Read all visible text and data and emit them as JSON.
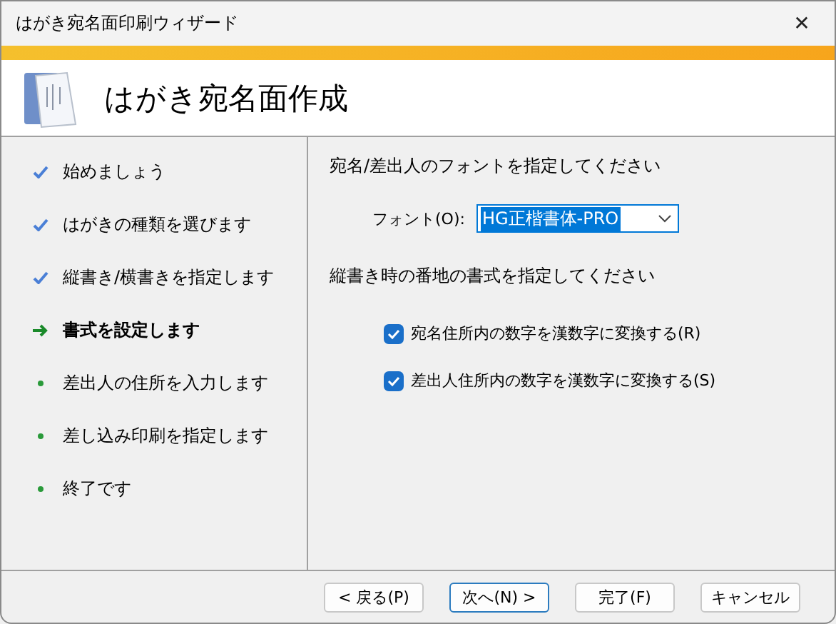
{
  "window": {
    "title": "はがき宛名面印刷ウィザード",
    "close": "✕"
  },
  "header": {
    "title": "はがき宛名面作成"
  },
  "steps": [
    {
      "label": "始めましょう",
      "kind": "done"
    },
    {
      "label": "はがきの種類を選びます",
      "kind": "done"
    },
    {
      "label": "縦書き/横書きを指定します",
      "kind": "done"
    },
    {
      "label": "書式を設定します",
      "kind": "current"
    },
    {
      "label": "差出人の住所を入力します",
      "kind": "pending"
    },
    {
      "label": "差し込み印刷を指定します",
      "kind": "pending"
    },
    {
      "label": "終了です",
      "kind": "pending"
    }
  ],
  "font_section": {
    "heading": "宛名/差出人のフォントを指定してください",
    "label": "フォント(O):",
    "value": "HG正楷書体-PRO"
  },
  "number_section": {
    "heading": "縦書き時の番地の書式を指定してください",
    "options": [
      {
        "label": "宛名住所内の数字を漢数字に変換する(R)",
        "checked": true
      },
      {
        "label": "差出人住所内の数字を漢数字に変換する(S)",
        "checked": true
      }
    ]
  },
  "buttons": [
    {
      "label": "< 戻る(P)",
      "default": false
    },
    {
      "label": "次へ(N) >",
      "default": true
    },
    {
      "label": "完了(F)",
      "default": false
    },
    {
      "label": "キャンセル",
      "default": false
    }
  ]
}
